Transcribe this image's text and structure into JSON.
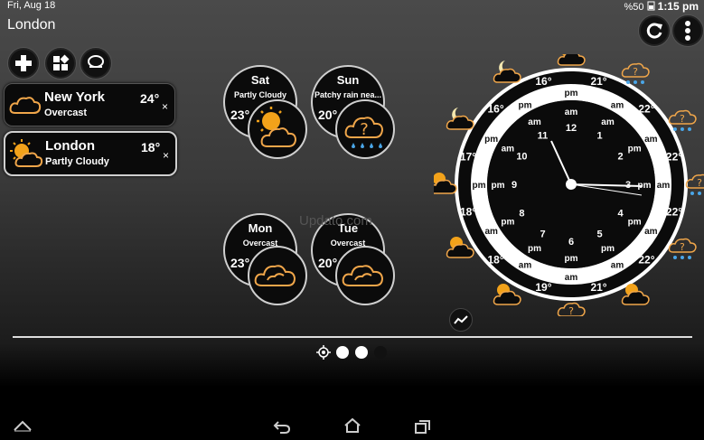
{
  "status": {
    "date": "Fri, Aug 18",
    "battery": "%50",
    "time": "1:15 pm"
  },
  "header": {
    "city": "London"
  },
  "toolbar": {
    "add_icon": "plus-icon",
    "layout_icon": "layout-icon",
    "chat_icon": "chat-bubble-icon",
    "refresh_icon": "refresh-icon",
    "menu_icon": "overflow-menu-icon"
  },
  "cities": [
    {
      "name": "New York",
      "condition": "Overcast",
      "temp": "24°",
      "icon": "cloud-icon",
      "close": "×"
    },
    {
      "name": "London",
      "condition": "Partly Cloudy",
      "temp": "18°",
      "icon": "sun-cloud-icon",
      "close": "×"
    }
  ],
  "forecast": [
    {
      "day": "Sat",
      "condition": "Partly Cloudy",
      "temp": "23°",
      "icon": "sun-cloud-icon"
    },
    {
      "day": "Sun",
      "condition": "Patchy rain nea...",
      "temp": "20°",
      "icon": "rain-unknown-icon"
    },
    {
      "day": "Mon",
      "condition": "Overcast",
      "temp": "23°",
      "icon": "cloud-icon"
    },
    {
      "day": "Tue",
      "condition": "Overcast",
      "temp": "20°",
      "icon": "cloud-icon"
    }
  ],
  "watermark": "Updato.com",
  "clock": {
    "hours": [
      "12",
      "1",
      "2",
      "3",
      "4",
      "5",
      "6",
      "7",
      "8",
      "9",
      "10",
      "11"
    ],
    "ring_am": "am",
    "ring_pm": "pm",
    "outer_temps": [
      "21°",
      "22°",
      "22°",
      "22°",
      "22°",
      "21°",
      "19°",
      "18°",
      "18°",
      "17°",
      "16°",
      "16°"
    ],
    "time_shown": "1:15"
  },
  "graph_icon": "trend-graph-icon",
  "pager": {
    "location_icon": "locate-icon",
    "pages": 3,
    "active": 1
  },
  "nav": {
    "home_up": "up-chevron-icon",
    "back": "back-icon",
    "home": "home-icon",
    "recents": "recents-icon"
  },
  "colors": {
    "sun": "#f2a21a",
    "cloud_outline": "#f0a64a",
    "rain": "#4aa6e8"
  }
}
